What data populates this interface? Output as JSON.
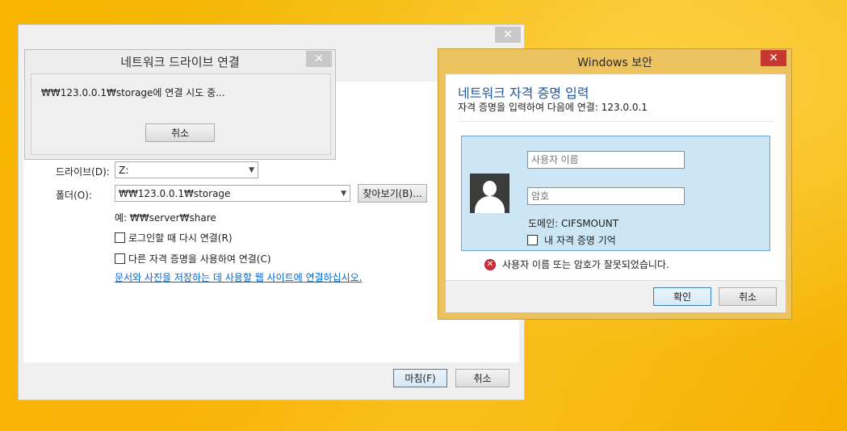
{
  "wizard": {
    "drive_label": "드라이브(D):",
    "drive_value": "Z:",
    "folder_label": "폴더(O):",
    "folder_value": "₩₩123.0.0.1₩storage",
    "browse_button": "찾아보기(B)...",
    "example_text": "예: ₩₩server₩share",
    "reconnect_label": "로그인할 때 다시 연결(R)",
    "other_creds_label": "다른 자격 증명을 사용하여 연결(C)",
    "website_link": "문서와 사진을 저장하는 데 사용할 웹 사이트에 연결하십시오.",
    "finish_button": "마침(F)",
    "cancel_button": "취소",
    "close_glyph": "✕"
  },
  "progress_dialog": {
    "title": "네트워크 드라이브 연결",
    "message": "₩₩123.0.0.1₩storage에 연결 시도 중...",
    "cancel_button": "취소",
    "close_glyph": "✕"
  },
  "security_dialog": {
    "title": "Windows 보안",
    "heading": "네트워크 자격 증명 입력",
    "subheading": "자격 증명을 입력하여 다음에 연결: 123.0.0.1",
    "username_placeholder": "사용자 이름",
    "password_placeholder": "암호",
    "domain_text": "도메인: CIFSMOUNT",
    "remember_label": "내 자격 증명 기억",
    "error_text": "사용자 이름 또는 암호가 잘못되었습니다.",
    "error_glyph": "✕",
    "ok_button": "확인",
    "cancel_button": "취소",
    "close_glyph": "✕"
  },
  "colors": {
    "desktop": "#f7b500",
    "security_frame": "#ecc35e",
    "close_red": "#c7372f",
    "credential_panel": "#cde6f5",
    "heading_blue": "#1c5aa6",
    "link_blue": "#0066cc"
  }
}
